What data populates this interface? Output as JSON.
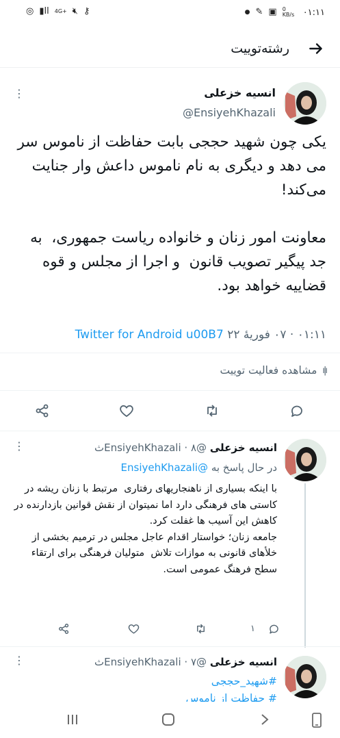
{
  "status_bar": {
    "time": "۰۱:۱۱",
    "speed": "0 KB/s",
    "network": "4G+"
  },
  "app_bar": {
    "title": "رشته‌توییت"
  },
  "main_tweet": {
    "author_name": "انسیه خزعلی",
    "author_handle": "@EnsiyehKhazali",
    "text": "یکی چون شهید حججی بابت حفاظت از ناموس سر می دهد و دیگری به نام ناموس داعش وار جنایت می‌کند!\n\nمعاونت امور زنان و خانواده ریاست جمهوری،  به جد پیگیر تصویب قانون  و اجرا از مجلس و قوه قضاییه خواهد بود.",
    "timestamp": "۰۱:۱۱ · ۰۷ فوریهٔ ۲۲",
    "source": "Twitter for Android u00B7",
    "activity_label": "مشاهده فعالیت توییت"
  },
  "replies": [
    {
      "author_name": "انسیه خزعلی",
      "author_handle": "@EnsiyehKhazali",
      "time": "۸ث",
      "replying_prefix": "در حال پاسخ به",
      "replying_to": "@EnsiyehKhazali",
      "text": "با اینکه بسیاری از ناهنجاریهای رفتاری  مرتبط با زنان ریشه در کاستی های فرهنگی دارد اما نمیتوان از نقش قوانین بازدارنده در کاهش این آسیب ها غفلت کرد.\nجامعه زنان؛ خواستار اقدام عاجل مجلس در ترمیم بخشی از خلأهای قانونی به موازات تلاش  متولیان فرهنگی برای ارتقاء سطح فرهنگ عمومی است.",
      "reply_count": "۱"
    },
    {
      "author_name": "انسیه خزعلی",
      "author_handle": "@EnsiyehKhazali",
      "time": "۷ث",
      "hashtag": "#شهید_حججی",
      "partial_text": "# حفاظت از ناموس"
    }
  ],
  "colors": {
    "link": "#1d9bf0",
    "muted": "#536471",
    "text": "#0f1419"
  }
}
